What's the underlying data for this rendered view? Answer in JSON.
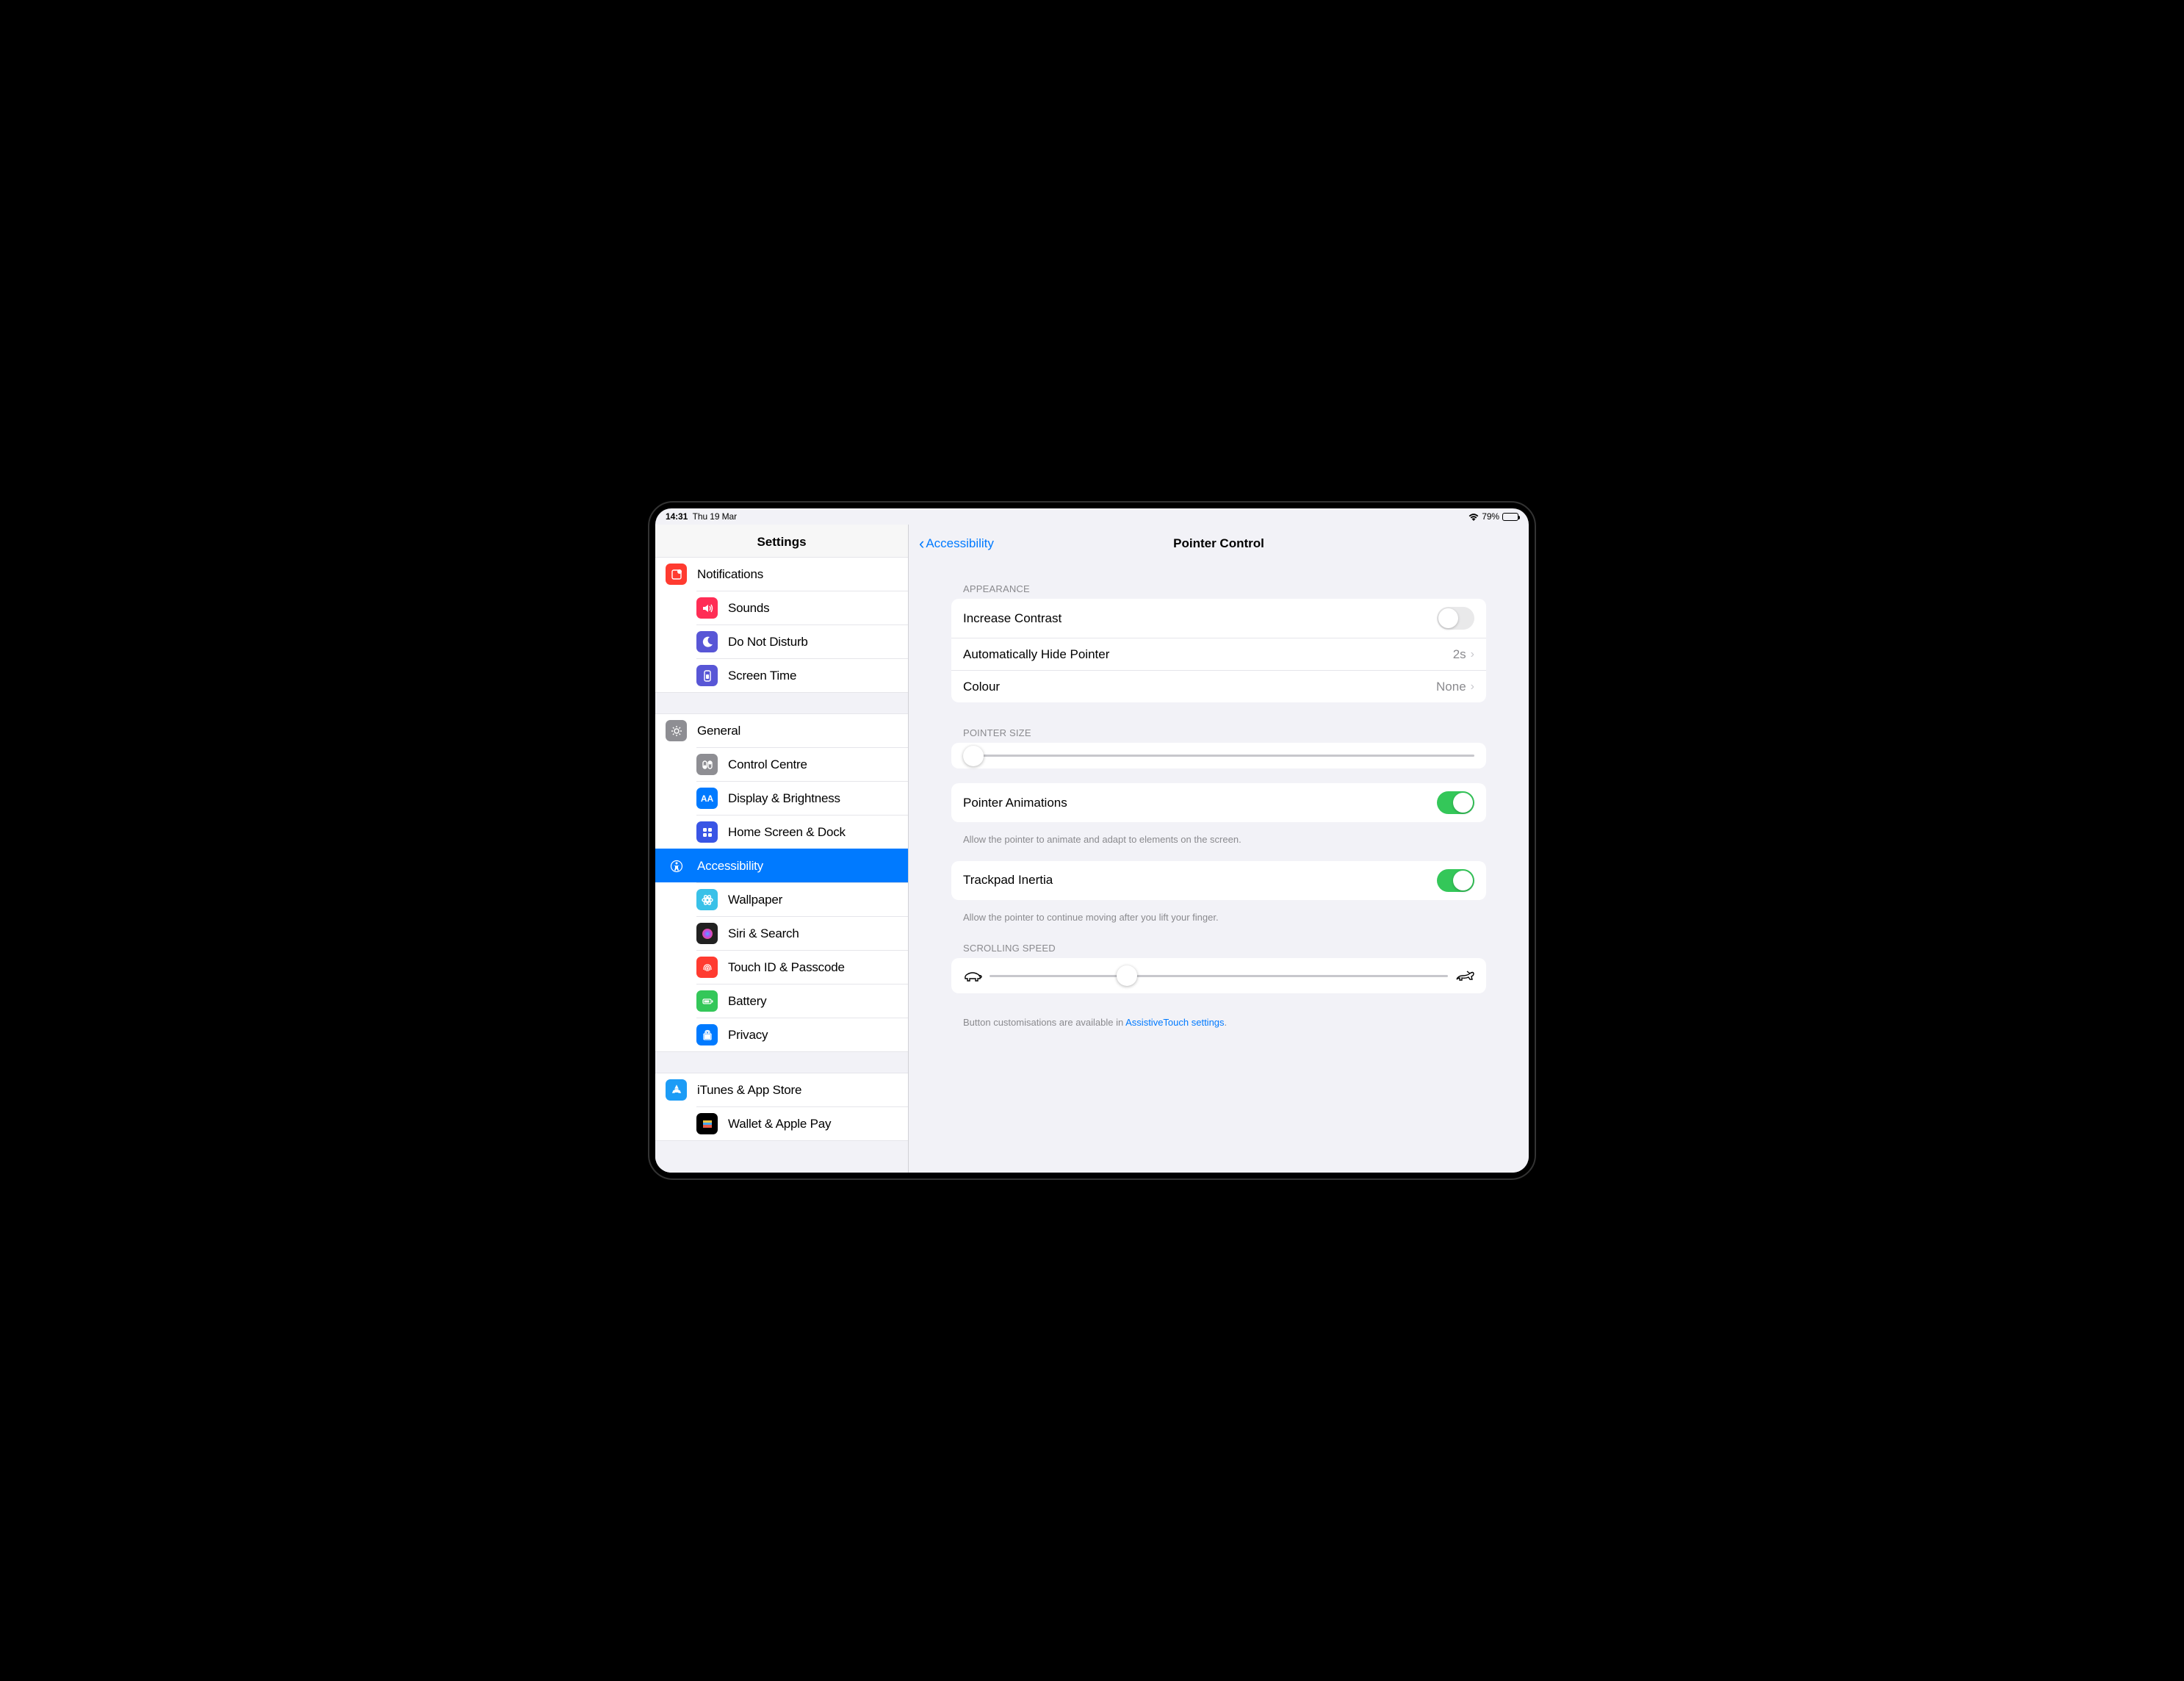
{
  "statusbar": {
    "time": "14:31",
    "date": "Thu 19 Mar",
    "battery": "79%"
  },
  "sidebar": {
    "title": "Settings",
    "groups": [
      [
        {
          "label": "Notifications",
          "color": "#ff3b30",
          "icon": "notifications"
        },
        {
          "label": "Sounds",
          "color": "#ff2d55",
          "icon": "sounds"
        },
        {
          "label": "Do Not Disturb",
          "color": "#5856d6",
          "icon": "dnd"
        },
        {
          "label": "Screen Time",
          "color": "#5856d6",
          "icon": "screentime"
        }
      ],
      [
        {
          "label": "General",
          "color": "#8e8e93",
          "icon": "general"
        },
        {
          "label": "Control Centre",
          "color": "#8e8e93",
          "icon": "controlcentre"
        },
        {
          "label": "Display & Brightness",
          "color": "#007aff",
          "icon": "display"
        },
        {
          "label": "Home Screen & Dock",
          "color": "#3955e5",
          "icon": "homescreen"
        },
        {
          "label": "Accessibility",
          "color": "#007aff",
          "icon": "accessibility",
          "selected": true
        },
        {
          "label": "Wallpaper",
          "color": "#39c1e8",
          "icon": "wallpaper"
        },
        {
          "label": "Siri & Search",
          "color": "#212121",
          "icon": "siri"
        },
        {
          "label": "Touch ID & Passcode",
          "color": "#ff3b30",
          "icon": "touchid"
        },
        {
          "label": "Battery",
          "color": "#34c759",
          "icon": "battery"
        },
        {
          "label": "Privacy",
          "color": "#007aff",
          "icon": "privacy"
        }
      ],
      [
        {
          "label": "iTunes & App Store",
          "color": "#1c9cf6",
          "icon": "appstore"
        },
        {
          "label": "Wallet & Apple Pay",
          "color": "#000000",
          "icon": "wallet"
        }
      ]
    ]
  },
  "content": {
    "back": "Accessibility",
    "title": "Pointer Control",
    "appearance_header": "APPEARANCE",
    "rows": {
      "increase_contrast": "Increase Contrast",
      "auto_hide": "Automatically Hide Pointer",
      "auto_hide_value": "2s",
      "colour": "Colour",
      "colour_value": "None"
    },
    "pointer_size_header": "POINTER SIZE",
    "pointer_animations": "Pointer Animations",
    "pointer_animations_footer": "Allow the pointer to animate and adapt to elements on the screen.",
    "trackpad_inertia": "Trackpad Inertia",
    "trackpad_inertia_footer": "Allow the pointer to continue moving after you lift your finger.",
    "scrolling_speed_header": "SCROLLING SPEED",
    "footer_text": "Button customisations are available in ",
    "footer_link": "AssistiveTouch settings",
    "footer_suffix": "."
  },
  "toggles": {
    "increase_contrast": false,
    "pointer_animations": true,
    "trackpad_inertia": true
  },
  "sliders": {
    "pointer_size_pct": 2,
    "scrolling_speed_pct": 30
  }
}
